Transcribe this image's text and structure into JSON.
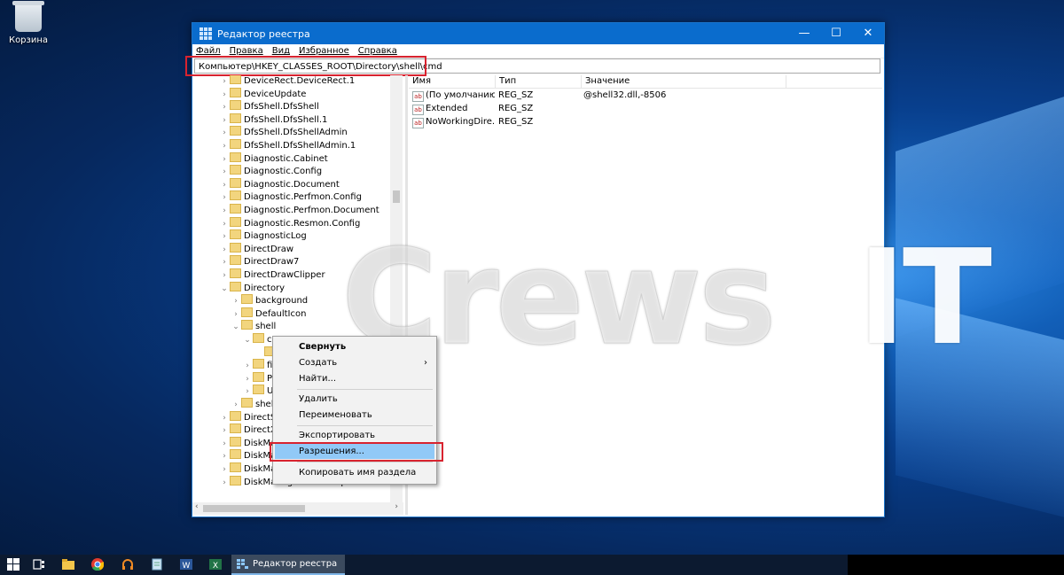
{
  "desktop": {
    "recycle_bin_label": "Корзина",
    "watermark_text_left": "Crews",
    "watermark_text_right": "IT"
  },
  "window": {
    "title": "Редактор реестра",
    "controls": {
      "minimize": "—",
      "maximize": "☐",
      "close": "✕"
    },
    "menu": [
      "Файл",
      "Правка",
      "Вид",
      "Избранное",
      "Справка"
    ],
    "address": "Компьютер\\HKEY_CLASSES_ROOT\\Directory\\shell\\cmd"
  },
  "tree": {
    "items": [
      {
        "label": "DeviceRect.DeviceRect.1",
        "expanded": false
      },
      {
        "label": "DeviceUpdate",
        "expanded": false
      },
      {
        "label": "DfsShell.DfsShell",
        "expanded": false
      },
      {
        "label": "DfsShell.DfsShell.1",
        "expanded": false
      },
      {
        "label": "DfsShell.DfsShellAdmin",
        "expanded": false
      },
      {
        "label": "DfsShell.DfsShellAdmin.1",
        "expanded": false
      },
      {
        "label": "Diagnostic.Cabinet",
        "expanded": false
      },
      {
        "label": "Diagnostic.Config",
        "expanded": false
      },
      {
        "label": "Diagnostic.Document",
        "expanded": false
      },
      {
        "label": "Diagnostic.Perfmon.Config",
        "expanded": false
      },
      {
        "label": "Diagnostic.Perfmon.Document",
        "expanded": false
      },
      {
        "label": "Diagnostic.Resmon.Config",
        "expanded": false
      },
      {
        "label": "DiagnosticLog",
        "expanded": false
      },
      {
        "label": "DirectDraw",
        "expanded": false
      },
      {
        "label": "DirectDraw7",
        "expanded": false
      },
      {
        "label": "DirectDrawClipper",
        "expanded": false
      },
      {
        "label": "Directory",
        "expanded": true
      },
      {
        "label": "background",
        "expanded": false
      },
      {
        "label": "DefaultIcon",
        "expanded": false
      },
      {
        "label": "shell",
        "expanded": true
      },
      {
        "label": "c",
        "expanded": true
      },
      {
        "label": "",
        "expanded": false
      },
      {
        "label": "fi",
        "expanded": false
      },
      {
        "label": "P",
        "expanded": false
      },
      {
        "label": "U",
        "expanded": false
      },
      {
        "label": "shell",
        "expanded": false
      },
      {
        "label": "DirectSl",
        "expanded": false
      },
      {
        "label": "DirectX",
        "expanded": false
      },
      {
        "label": "DiskMa",
        "expanded": false
      },
      {
        "label": "DiskMa",
        "expanded": false
      },
      {
        "label": "DiskMa",
        "expanded": false
      },
      {
        "label": "DiskManagement.SnapInAbout",
        "expanded": false
      }
    ]
  },
  "list": {
    "columns": [
      "Имя",
      "Тип",
      "Значение"
    ],
    "rows": [
      {
        "name": "(По умолчанию)",
        "type": "REG_SZ",
        "value": "@shell32.dll,-8506"
      },
      {
        "name": "Extended",
        "type": "REG_SZ",
        "value": ""
      },
      {
        "name": "NoWorkingDire...",
        "type": "REG_SZ",
        "value": ""
      }
    ],
    "value_icon_text": "ab"
  },
  "context_menu": {
    "items": [
      {
        "label": "Свернуть",
        "bold": true
      },
      {
        "label": "Создать",
        "submenu": "›"
      },
      {
        "label": "Найти..."
      },
      {
        "label": "Удалить"
      },
      {
        "label": "Переименовать"
      },
      {
        "label": "Экспортировать"
      },
      {
        "label": "Разрешения...",
        "selected": true
      },
      {
        "label": "Копировать имя раздела"
      }
    ]
  },
  "scroll": {
    "left_arrow": "‹",
    "right_arrow": "›"
  },
  "taskbar": {
    "active_app_label": "Редактор реестра"
  }
}
